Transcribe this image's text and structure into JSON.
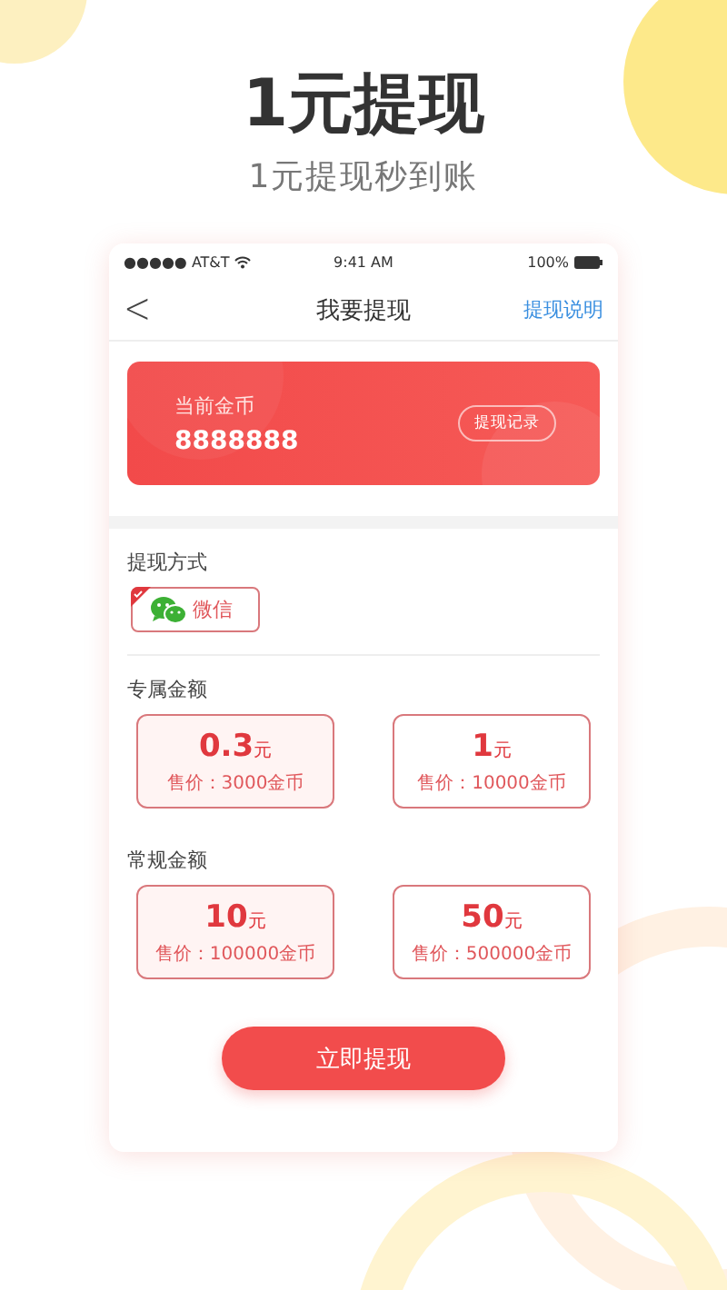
{
  "headline": {
    "title": "1元提现",
    "subtitle": "1元提现秒到账"
  },
  "status_bar": {
    "carrier": "●●●●● AT&T",
    "time": "9:41 AM",
    "battery": "100%"
  },
  "nav": {
    "back": "<",
    "title": "我要提现",
    "action": "提现说明"
  },
  "balance": {
    "label": "当前金币",
    "value": "8888888",
    "history_button": "提现记录"
  },
  "method": {
    "label": "提现方式",
    "options": [
      {
        "label": "微信",
        "selected": true
      }
    ]
  },
  "groups": [
    {
      "label": "专属金额",
      "amounts": [
        {
          "amount": "0.3",
          "unit": "元",
          "price": "售价：3000金币",
          "selected": true
        },
        {
          "amount": "1",
          "unit": "元",
          "price": "售价：10000金币",
          "selected": false
        }
      ]
    },
    {
      "label": "常规金额",
      "amounts": [
        {
          "amount": "10",
          "unit": "元",
          "price": "售价：100000金币",
          "selected": true
        },
        {
          "amount": "50",
          "unit": "元",
          "price": "售价：500000金币",
          "selected": false
        }
      ]
    }
  ],
  "submit": "立即提现"
}
